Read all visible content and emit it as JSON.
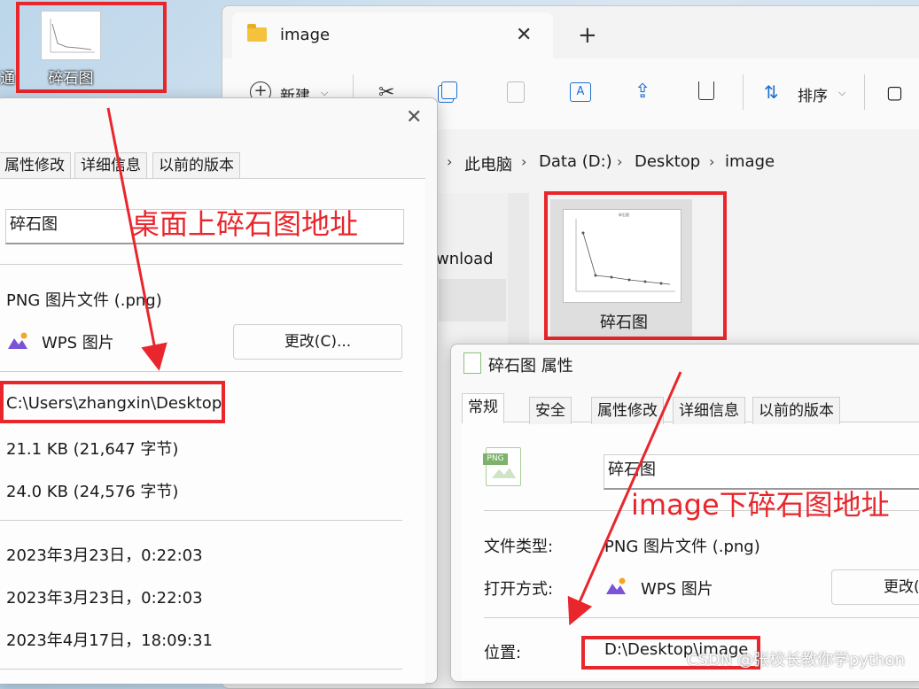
{
  "desktop": {
    "left_label": "通",
    "icon_label": "碎石图"
  },
  "explorer": {
    "tab_title": "image",
    "tab_close": "✕",
    "tab_add": "+",
    "toolbar": {
      "new_label": "新建",
      "sort_label": "排序",
      "view_symbol": "▢"
    },
    "breadcrumb": [
      "此电脑",
      "Data (D:)",
      "Desktop",
      "image"
    ],
    "nav_partial_item": "wnload",
    "file": {
      "name": "碎石图",
      "thumb_title": "碎石图"
    }
  },
  "left_dialog": {
    "close": "✕",
    "tabs": [
      "属性修改",
      "详细信息",
      "以前的版本"
    ],
    "file_name": "碎石图",
    "file_type": "PNG 图片文件 (.png)",
    "open_with": "WPS 图片",
    "change_button": "更改(C)...",
    "location": "C:\\Users\\zhangxin\\Desktop",
    "size": "21.1 KB (21,647 字节)",
    "size_on_disk": "24.0 KB (24,576 字节)",
    "created": "2023年3月23日，0:22:03",
    "modified": "2023年3月23日，0:22:03",
    "accessed": "2023年4月17日，18:09:31"
  },
  "right_dialog": {
    "title": "碎石图 属性",
    "tabs": [
      "常规",
      "安全",
      "属性修改",
      "详细信息",
      "以前的版本"
    ],
    "icon_badge": "PNG",
    "file_name": "碎石图",
    "type_label": "文件类型:",
    "type_value": "PNG 图片文件 (.png)",
    "open_label": "打开方式:",
    "open_value": "WPS 图片",
    "change_button": "更改(",
    "location_label": "位置:",
    "location_value": "D:\\Desktop\\image"
  },
  "annotations": {
    "desktop_note": "桌面上碎石图地址",
    "image_note": "image下碎石图地址",
    "color": "#e8262c"
  },
  "watermark": "CSDN @张校长教你学python"
}
